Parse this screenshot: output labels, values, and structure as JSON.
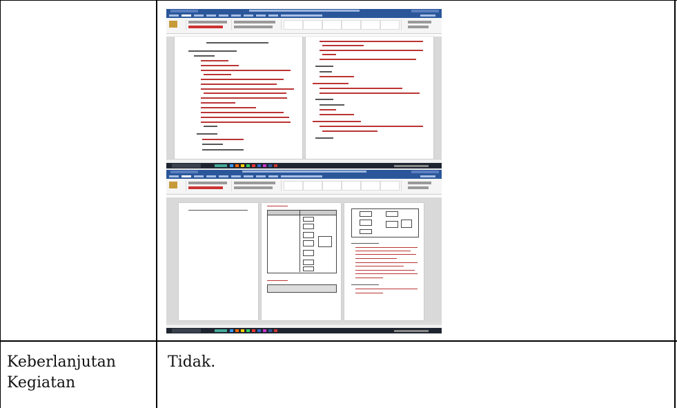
{
  "table": {
    "row2_label": "Keberlanjutan Kegiatan",
    "row2_label_line1": "Keberlanjutan",
    "row2_label_line2": "Kegiatan",
    "row2_value": "Tidak."
  },
  "screenshot": {
    "top_window_title": "PROSES PENYELENGGARAAN KEGIATAN - Word",
    "bottom_window_title": "SOP DIAGRAM PROPOSAL (BREAK KEBELAKANG) - Word",
    "top_doc_heading": "PROSES PENYELENGGARAAN KEGIATAN",
    "search_label": "Search",
    "colors": {
      "word_blue": "#2b579a",
      "taskbar": "#1f2530",
      "markup_red": "#b33333"
    }
  }
}
